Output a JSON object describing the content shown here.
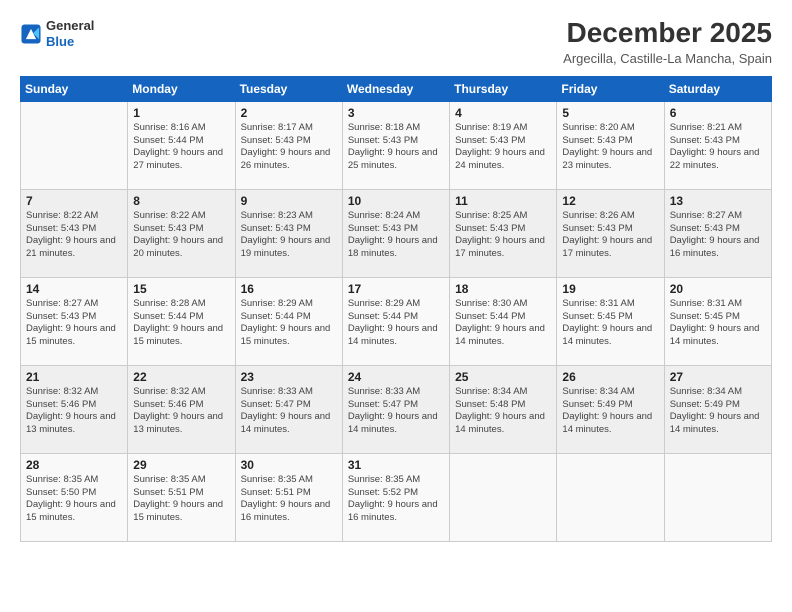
{
  "logo": {
    "line1": "General",
    "line2": "Blue"
  },
  "title": "December 2025",
  "location": "Argecilla, Castille-La Mancha, Spain",
  "weekdays": [
    "Sunday",
    "Monday",
    "Tuesday",
    "Wednesday",
    "Thursday",
    "Friday",
    "Saturday"
  ],
  "weeks": [
    [
      {
        "day": "",
        "info": ""
      },
      {
        "day": "1",
        "info": "Sunrise: 8:16 AM\nSunset: 5:44 PM\nDaylight: 9 hours\nand 27 minutes."
      },
      {
        "day": "2",
        "info": "Sunrise: 8:17 AM\nSunset: 5:43 PM\nDaylight: 9 hours\nand 26 minutes."
      },
      {
        "day": "3",
        "info": "Sunrise: 8:18 AM\nSunset: 5:43 PM\nDaylight: 9 hours\nand 25 minutes."
      },
      {
        "day": "4",
        "info": "Sunrise: 8:19 AM\nSunset: 5:43 PM\nDaylight: 9 hours\nand 24 minutes."
      },
      {
        "day": "5",
        "info": "Sunrise: 8:20 AM\nSunset: 5:43 PM\nDaylight: 9 hours\nand 23 minutes."
      },
      {
        "day": "6",
        "info": "Sunrise: 8:21 AM\nSunset: 5:43 PM\nDaylight: 9 hours\nand 22 minutes."
      }
    ],
    [
      {
        "day": "7",
        "info": "Sunrise: 8:22 AM\nSunset: 5:43 PM\nDaylight: 9 hours\nand 21 minutes."
      },
      {
        "day": "8",
        "info": "Sunrise: 8:22 AM\nSunset: 5:43 PM\nDaylight: 9 hours\nand 20 minutes."
      },
      {
        "day": "9",
        "info": "Sunrise: 8:23 AM\nSunset: 5:43 PM\nDaylight: 9 hours\nand 19 minutes."
      },
      {
        "day": "10",
        "info": "Sunrise: 8:24 AM\nSunset: 5:43 PM\nDaylight: 9 hours\nand 18 minutes."
      },
      {
        "day": "11",
        "info": "Sunrise: 8:25 AM\nSunset: 5:43 PM\nDaylight: 9 hours\nand 17 minutes."
      },
      {
        "day": "12",
        "info": "Sunrise: 8:26 AM\nSunset: 5:43 PM\nDaylight: 9 hours\nand 17 minutes."
      },
      {
        "day": "13",
        "info": "Sunrise: 8:27 AM\nSunset: 5:43 PM\nDaylight: 9 hours\nand 16 minutes."
      }
    ],
    [
      {
        "day": "14",
        "info": "Sunrise: 8:27 AM\nSunset: 5:43 PM\nDaylight: 9 hours\nand 15 minutes."
      },
      {
        "day": "15",
        "info": "Sunrise: 8:28 AM\nSunset: 5:44 PM\nDaylight: 9 hours\nand 15 minutes."
      },
      {
        "day": "16",
        "info": "Sunrise: 8:29 AM\nSunset: 5:44 PM\nDaylight: 9 hours\nand 15 minutes."
      },
      {
        "day": "17",
        "info": "Sunrise: 8:29 AM\nSunset: 5:44 PM\nDaylight: 9 hours\nand 14 minutes."
      },
      {
        "day": "18",
        "info": "Sunrise: 8:30 AM\nSunset: 5:44 PM\nDaylight: 9 hours\nand 14 minutes."
      },
      {
        "day": "19",
        "info": "Sunrise: 8:31 AM\nSunset: 5:45 PM\nDaylight: 9 hours\nand 14 minutes."
      },
      {
        "day": "20",
        "info": "Sunrise: 8:31 AM\nSunset: 5:45 PM\nDaylight: 9 hours\nand 14 minutes."
      }
    ],
    [
      {
        "day": "21",
        "info": "Sunrise: 8:32 AM\nSunset: 5:46 PM\nDaylight: 9 hours\nand 13 minutes."
      },
      {
        "day": "22",
        "info": "Sunrise: 8:32 AM\nSunset: 5:46 PM\nDaylight: 9 hours\nand 13 minutes."
      },
      {
        "day": "23",
        "info": "Sunrise: 8:33 AM\nSunset: 5:47 PM\nDaylight: 9 hours\nand 14 minutes."
      },
      {
        "day": "24",
        "info": "Sunrise: 8:33 AM\nSunset: 5:47 PM\nDaylight: 9 hours\nand 14 minutes."
      },
      {
        "day": "25",
        "info": "Sunrise: 8:34 AM\nSunset: 5:48 PM\nDaylight: 9 hours\nand 14 minutes."
      },
      {
        "day": "26",
        "info": "Sunrise: 8:34 AM\nSunset: 5:49 PM\nDaylight: 9 hours\nand 14 minutes."
      },
      {
        "day": "27",
        "info": "Sunrise: 8:34 AM\nSunset: 5:49 PM\nDaylight: 9 hours\nand 14 minutes."
      }
    ],
    [
      {
        "day": "28",
        "info": "Sunrise: 8:35 AM\nSunset: 5:50 PM\nDaylight: 9 hours\nand 15 minutes."
      },
      {
        "day": "29",
        "info": "Sunrise: 8:35 AM\nSunset: 5:51 PM\nDaylight: 9 hours\nand 15 minutes."
      },
      {
        "day": "30",
        "info": "Sunrise: 8:35 AM\nSunset: 5:51 PM\nDaylight: 9 hours\nand 16 minutes."
      },
      {
        "day": "31",
        "info": "Sunrise: 8:35 AM\nSunset: 5:52 PM\nDaylight: 9 hours\nand 16 minutes."
      },
      {
        "day": "",
        "info": ""
      },
      {
        "day": "",
        "info": ""
      },
      {
        "day": "",
        "info": ""
      }
    ]
  ]
}
